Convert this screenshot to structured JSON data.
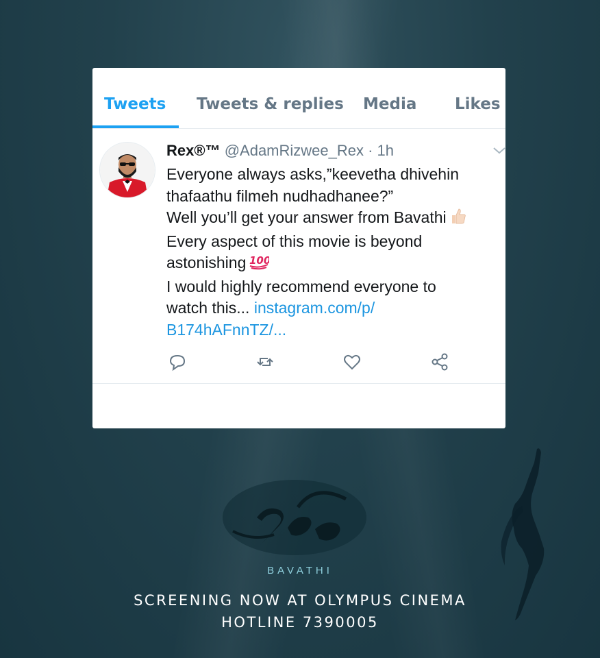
{
  "tabs": [
    {
      "label": "Tweets",
      "active": true
    },
    {
      "label": "Tweets & replies",
      "active": false
    },
    {
      "label": "Media",
      "active": false
    },
    {
      "label": "Likes",
      "active": false
    }
  ],
  "tweet": {
    "author_name": "Rex®™",
    "handle_time": "@AdamRizwee_Rex · 1h",
    "lines": [
      "Everyone always asks,”keevetha dhivehin",
      "thafaathu filmeh nudhadhanee?”",
      "Well you’ll get your answer from Bavathi",
      "Every aspect of this movie is beyond",
      "astonishing",
      "I would highly recommend everyone to",
      "watch this..."
    ],
    "link_part1": "instagram.com/p/",
    "link_part2": "B174hAFnnTZ/...",
    "emoji": [
      "thumbs-up",
      "hundred-points"
    ]
  },
  "actions": [
    "reply-icon",
    "retweet-icon",
    "like-icon",
    "share-icon"
  ],
  "poster": {
    "brand": "BAVATHI",
    "screening": "SCREENING NOW AT OLYMPUS CINEMA",
    "hotline": "HOTLINE 7390005"
  },
  "colors": {
    "accent": "#1da1f2",
    "link": "#1b95e0",
    "background": "#22414c"
  }
}
